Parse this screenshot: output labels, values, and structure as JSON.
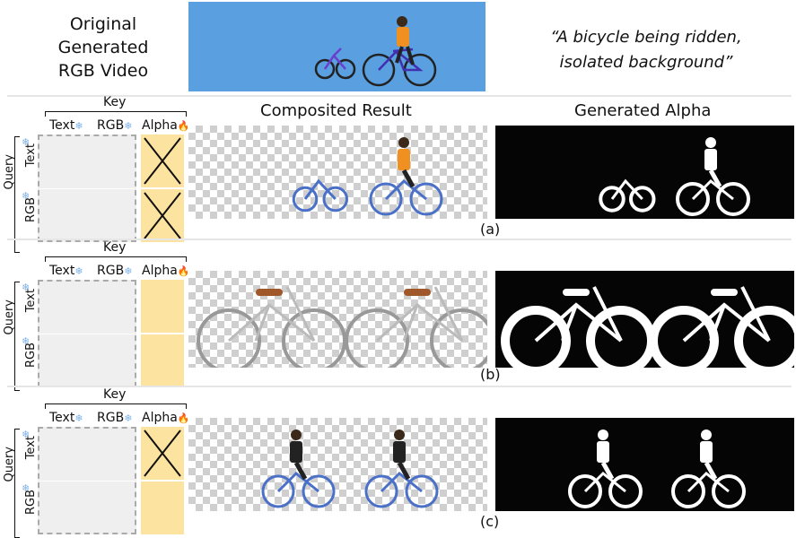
{
  "header": {
    "original_label": [
      "Original",
      "Generated",
      "RGB Video"
    ],
    "prompt_line1": "“A bicycle being ridden,",
    "prompt_line2": "isolated background”",
    "composited_title": "Composited Result",
    "alpha_title": "Generated Alpha"
  },
  "attention": {
    "key_label": "Key",
    "query_label": "Query",
    "col_text": "Text",
    "col_rgb": "RGB",
    "col_alpha": "Alpha",
    "row_text": "Text",
    "row_rgb": "RGB",
    "snow_glyph": "❄",
    "fire_glyph": "🔥"
  },
  "panels": [
    {
      "tag": "(a)",
      "alpha_text_masked": true,
      "alpha_rgb_masked": true,
      "subject": "bicycle-rider-colored"
    },
    {
      "tag": "(b)",
      "alpha_text_masked": false,
      "alpha_rgb_masked": false,
      "subject": "city-bicycle"
    },
    {
      "tag": "(c)",
      "alpha_text_masked": true,
      "alpha_rgb_masked": false,
      "subject": "cyclist"
    }
  ],
  "colors": {
    "video_bg": "#5a9fe0",
    "alpha_cell": "#fde3a0",
    "grid_bg": "#efefef",
    "snow": "#7fb3e8",
    "fire": "#d62020"
  }
}
